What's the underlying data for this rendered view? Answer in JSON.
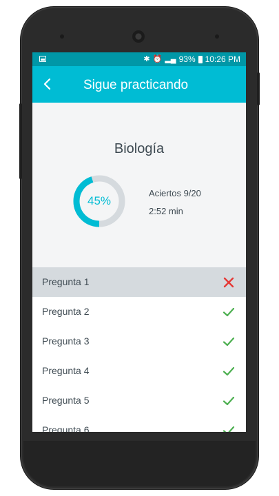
{
  "status_bar": {
    "battery": "93%",
    "time": "10:26 PM"
  },
  "app_bar": {
    "title": "Sigue practicando"
  },
  "summary": {
    "subject": "Biología",
    "score_percent_label": "45%",
    "score_fraction": 0.45,
    "hits_label": "Aciertos 9/20",
    "time_label": "2:52 min"
  },
  "colors": {
    "primary": "#00bcd4",
    "primary_dark": "#0097a7",
    "wrong": "#e53935",
    "correct": "#4caf50",
    "track": "#d5dade"
  },
  "questions": [
    {
      "label": "Pregunta 1",
      "result": "wrong"
    },
    {
      "label": "Pregunta 2",
      "result": "correct"
    },
    {
      "label": "Pregunta 3",
      "result": "correct"
    },
    {
      "label": "Pregunta 4",
      "result": "correct"
    },
    {
      "label": "Pregunta 5",
      "result": "correct"
    },
    {
      "label": "Pregunta 6",
      "result": "correct"
    }
  ]
}
